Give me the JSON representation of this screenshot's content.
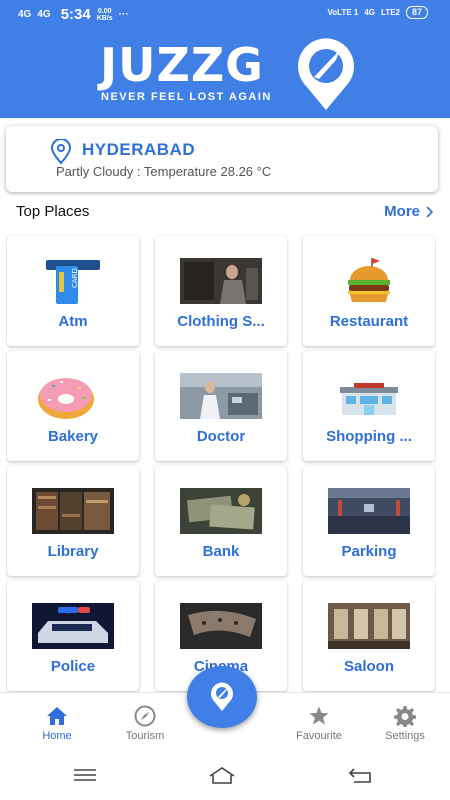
{
  "status_bar": {
    "network_left": [
      "4G",
      "4G"
    ],
    "time": "5:34",
    "speed_value": "0.00",
    "speed_unit": "KB/s",
    "dots": "···",
    "operator": "VoLTE 1",
    "network_right": "4G",
    "lte": "LTE2",
    "battery": "87"
  },
  "header": {
    "logo": "JUZZG",
    "tagline": "NEVER FEEL LOST AGAIN"
  },
  "city": {
    "name": "HYDERABAD",
    "weather": "Partly Cloudy : Temperature 28.26 °C"
  },
  "section": {
    "title": "Top Places",
    "more": "More"
  },
  "places": [
    {
      "label": "Atm",
      "icon": "atm-card-icon"
    },
    {
      "label": "Clothing S...",
      "icon": "clothing-photo"
    },
    {
      "label": "Restaurant",
      "icon": "burger-icon"
    },
    {
      "label": "Bakery",
      "icon": "donut-icon"
    },
    {
      "label": "Doctor",
      "icon": "doctor-photo"
    },
    {
      "label": "Shopping ...",
      "icon": "mall-icon"
    },
    {
      "label": "Library",
      "icon": "library-photo"
    },
    {
      "label": "Bank",
      "icon": "bank-photo"
    },
    {
      "label": "Parking",
      "icon": "parking-photo"
    },
    {
      "label": "Police",
      "icon": "police-photo"
    },
    {
      "label": "Cinema",
      "icon": "cinema-photo"
    },
    {
      "label": "Saloon",
      "icon": "saloon-photo"
    }
  ],
  "bottom_nav": {
    "home": "Home",
    "tourism": "Tourism",
    "favourite": "Favourite",
    "settings": "Settings"
  },
  "colors": {
    "primary": "#3f7fe6",
    "accent_text": "#2e6fd8"
  }
}
